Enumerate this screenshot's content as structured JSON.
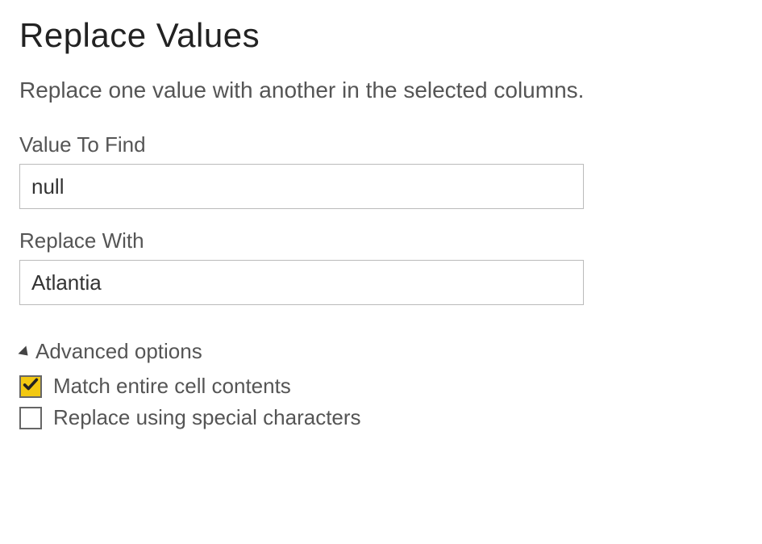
{
  "dialog": {
    "title": "Replace Values",
    "description": "Replace one value with another in the selected columns."
  },
  "fields": {
    "valueToFind": {
      "label": "Value To Find",
      "value": "null"
    },
    "replaceWith": {
      "label": "Replace With",
      "value": "Atlantia"
    }
  },
  "advanced": {
    "header": "Advanced options",
    "options": {
      "matchEntire": {
        "label": "Match entire cell contents",
        "checked": true
      },
      "specialChars": {
        "label": "Replace using special characters",
        "checked": false
      }
    }
  }
}
